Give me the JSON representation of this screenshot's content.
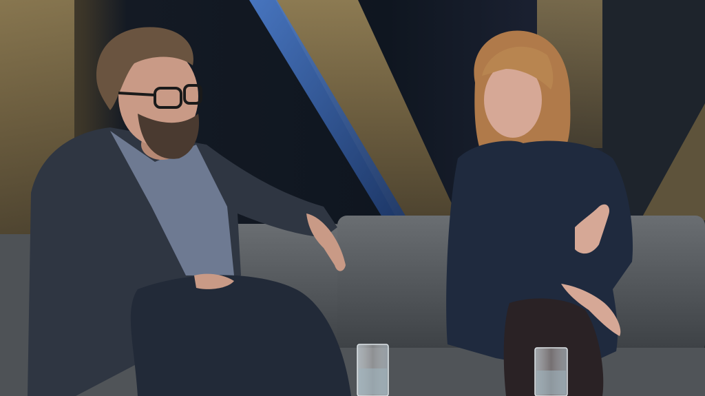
{
  "scene": {
    "palette": {
      "backdrop_dark": "#15202c",
      "backdrop_gold": "#8a7448",
      "backdrop_blue_stripe": "#3a6ab8",
      "sofa_grey": "#5a5e62",
      "man_jacket": "#2f3642",
      "man_shirt": "#6e7a92",
      "woman_dress": "#1f2a3e",
      "woman_hair": "#b07a4a",
      "skin": "#c99a86",
      "tights": "#2a2225"
    }
  }
}
